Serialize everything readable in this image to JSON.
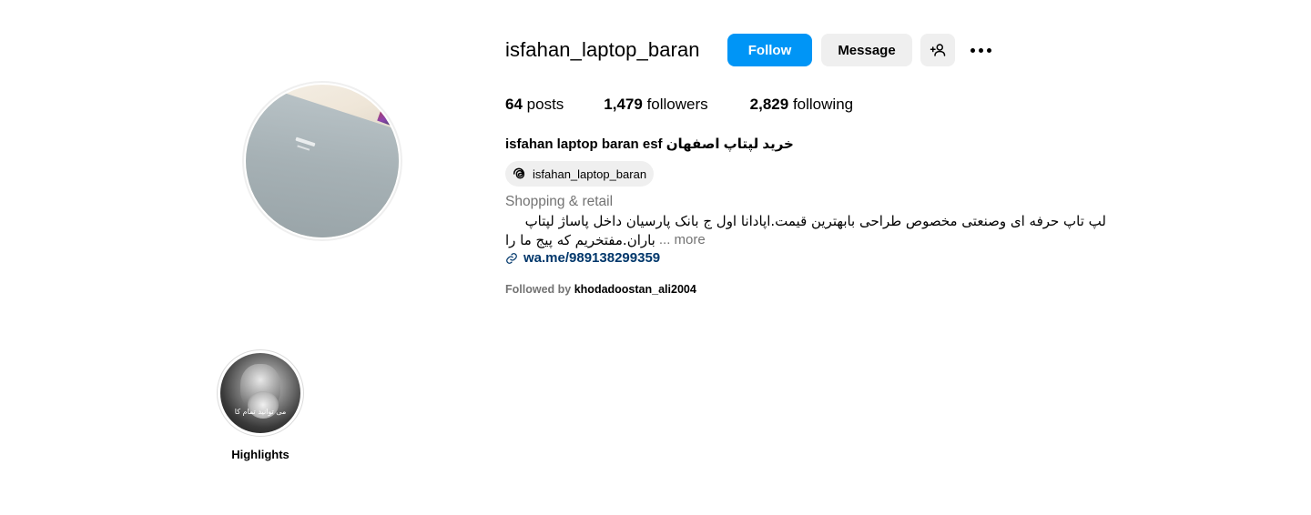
{
  "profile": {
    "username": "isfahan_laptop_baran",
    "follow_label": "Follow",
    "message_label": "Message",
    "add_user_icon": "add-user-icon",
    "more_icon": "more-options-icon",
    "stats": {
      "posts_count": "64",
      "posts_label": "posts",
      "followers_count": "1,479",
      "followers_label": "followers",
      "following_count": "2,829",
      "following_label": "following"
    },
    "full_name": "isfahan laptop baran esf خرید لپتاپ اصفهان",
    "threads_handle": "isfahan_laptop_baran",
    "category": "Shopping & retail",
    "bio_line1": "لپ تاپ حرفه ای وصنعتی مخصوص طراحی بابهترین قیمت.اپادانا اول ج بانک پارسیان داخل پاساژ لپتاپ",
    "bio_line2": "باران.مفتخریم که پیج ما را",
    "more_label": "... more",
    "link": "wa.me/989138299359",
    "followed_by_label": "Followed by",
    "followed_by_account": "khodadoostan_ali2004"
  },
  "highlights": [
    {
      "label": "Highlights",
      "overlay_text": "می توانید تمام کا"
    }
  ],
  "colors": {
    "follow_button": "#0095f6",
    "secondary_button": "#efefef",
    "muted_text": "#737373",
    "link_text": "#00376b"
  }
}
